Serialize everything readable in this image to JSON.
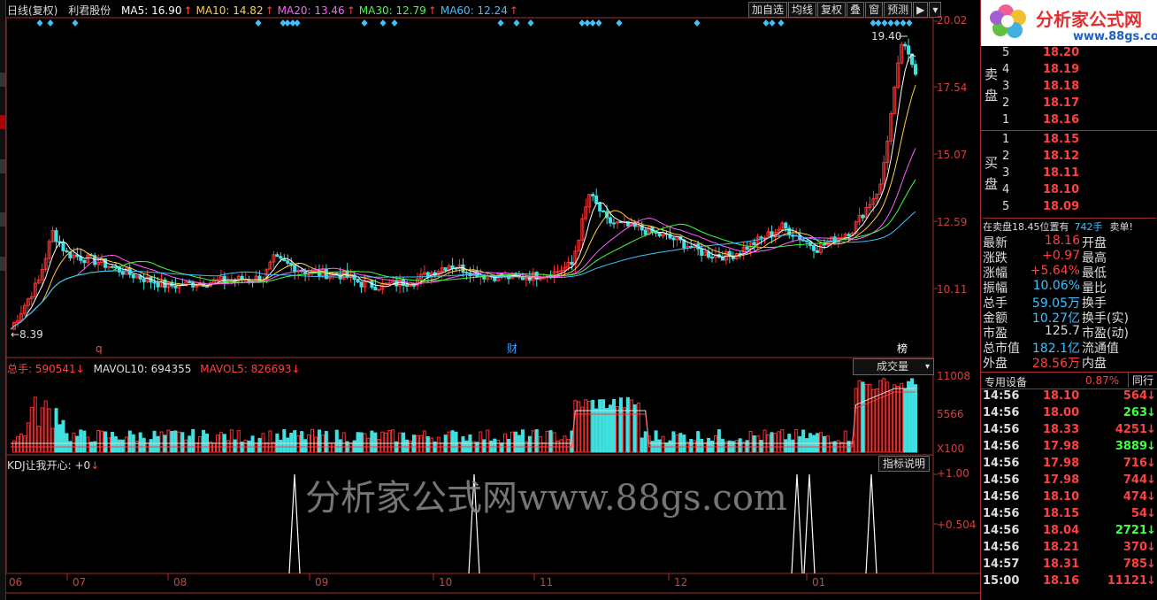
{
  "header": {
    "period": "日线(复权)",
    "stock_name": "利君股份",
    "ma": [
      {
        "label": "MA5: 16.90",
        "color": "#ffffff"
      },
      {
        "label": "MA10: 14.82",
        "color": "#ffd040"
      },
      {
        "label": "MA20: 13.46",
        "color": "#ff60ff"
      },
      {
        "label": "MA30: 12.79",
        "color": "#40ff40"
      },
      {
        "label": "MA60: 12.24",
        "color": "#40c0ff"
      }
    ],
    "arrow": "↑"
  },
  "toolbar": {
    "buttons": [
      "加自选",
      "均线",
      "复权",
      "叠",
      "窗",
      "预测"
    ],
    "menu_icon": "▶",
    "collapse_icon": "▾"
  },
  "main_chart": {
    "yaxis": [
      "20.02",
      "17.54",
      "15.07",
      "12.59",
      "10.11"
    ],
    "high_label": "19.40",
    "low_label": "8.39",
    "markers": [
      "q",
      "财",
      "榜"
    ]
  },
  "volume_panel": {
    "title": "总手: 590541",
    "mavol10": "MAVOL10: 694355",
    "mavol5": "MAVOL5: 826693",
    "down_arrow": "↓",
    "dropdown": "成交量",
    "yaxis": [
      "11008",
      "5566",
      "X100"
    ]
  },
  "kdj_panel": {
    "title": "KDJ让我开心: +0",
    "button": "指标说明",
    "yaxis": [
      "+1.00",
      "+0.504"
    ],
    "watermark": "分析家公式网www.88gs.com"
  },
  "xaxis": [
    "06",
    "07",
    "08",
    "09",
    "10",
    "11",
    "12",
    "01"
  ],
  "logo": {
    "text": "分析家公式网",
    "url": "www.88gs.com"
  },
  "orderbook": {
    "sell_label": [
      "卖",
      "盘"
    ],
    "buy_label": [
      "买",
      "盘"
    ],
    "sell": [
      {
        "idx": "5",
        "price": "18.20"
      },
      {
        "idx": "4",
        "price": "18.19"
      },
      {
        "idx": "3",
        "price": "18.18"
      },
      {
        "idx": "2",
        "price": "18.17"
      },
      {
        "idx": "1",
        "price": "18.16"
      }
    ],
    "buy": [
      {
        "idx": "1",
        "price": "18.15"
      },
      {
        "idx": "2",
        "price": "18.12"
      },
      {
        "idx": "3",
        "price": "18.11"
      },
      {
        "idx": "4",
        "price": "18.10"
      },
      {
        "idx": "5",
        "price": "18.09"
      }
    ],
    "notice_prefix": "在卖盘18.45位置有",
    "notice_qty": "742手",
    "notice_suffix": "卖单!"
  },
  "info": [
    {
      "k": "最新",
      "v": "18.16",
      "c": "red",
      "k2": "开盘"
    },
    {
      "k": "涨跌",
      "v": "+0.97",
      "c": "red",
      "k2": "最高"
    },
    {
      "k": "涨幅",
      "v": "+5.64%",
      "c": "red",
      "k2": "最低"
    },
    {
      "k": "振幅",
      "v": "10.06%",
      "c": "blue",
      "k2": "量比"
    },
    {
      "k": "总手",
      "v": "59.05万",
      "c": "blue",
      "k2": "换手"
    },
    {
      "k": "金额",
      "v": "10.27亿",
      "c": "blue",
      "k2": "换手(实)"
    },
    {
      "k": "市盈",
      "v": "125.7",
      "c": "white",
      "k2": "市盈(动)"
    },
    {
      "k": "总市值",
      "v": "182.1亿",
      "c": "blue",
      "k2": "流通值"
    },
    {
      "k": "外盘",
      "v": "28.56万",
      "c": "red",
      "k2": "内盘"
    }
  ],
  "sector": {
    "name": "专用设备",
    "pct": "0.87%",
    "tab": "同行"
  },
  "ticks": [
    {
      "t": "14:56",
      "p": "18.10",
      "v": "564",
      "pc": "#ff4040",
      "vc": "#ff4040",
      "a": "↓"
    },
    {
      "t": "14:56",
      "p": "18.00",
      "v": "263",
      "pc": "#ff4040",
      "vc": "#40ff40",
      "a": "↓"
    },
    {
      "t": "14:56",
      "p": "18.33",
      "v": "4251",
      "pc": "#ff4040",
      "vc": "#ff4040",
      "a": "↓"
    },
    {
      "t": "14:56",
      "p": "17.98",
      "v": "3889",
      "pc": "#ff4040",
      "vc": "#40ff40",
      "a": "↓"
    },
    {
      "t": "14:56",
      "p": "17.98",
      "v": "716",
      "pc": "#ff4040",
      "vc": "#ff4040",
      "a": "↓"
    },
    {
      "t": "14:56",
      "p": "17.98",
      "v": "744",
      "pc": "#ff4040",
      "vc": "#ff4040",
      "a": "↓"
    },
    {
      "t": "14:56",
      "p": "18.10",
      "v": "474",
      "pc": "#ff4040",
      "vc": "#ff4040",
      "a": "↓"
    },
    {
      "t": "14:56",
      "p": "18.15",
      "v": "54",
      "pc": "#ff4040",
      "vc": "#ff4040",
      "a": "↓"
    },
    {
      "t": "14:56",
      "p": "18.04",
      "v": "2721",
      "pc": "#ff4040",
      "vc": "#40ff40",
      "a": "↓"
    },
    {
      "t": "14:56",
      "p": "18.21",
      "v": "370",
      "pc": "#ff4040",
      "vc": "#ff4040",
      "a": "↓"
    },
    {
      "t": "14:57",
      "p": "18.31",
      "v": "785",
      "pc": "#ff4040",
      "vc": "#ff4040",
      "a": "↓"
    },
    {
      "t": "15:00",
      "p": "18.16",
      "v": "11121",
      "pc": "#ff4040",
      "vc": "#ff4040",
      "a": "↓"
    }
  ],
  "colors": {
    "up": "#ff3030",
    "down": "#40e0e0",
    "grid": "#a03030"
  }
}
